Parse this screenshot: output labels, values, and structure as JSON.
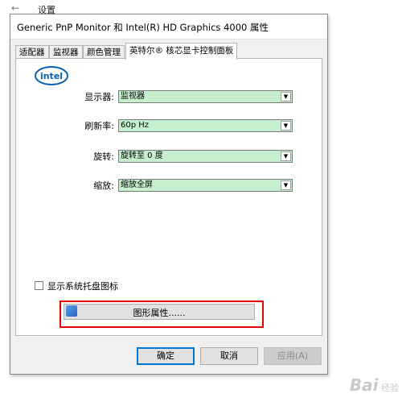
{
  "background_window": {
    "back_glyph": "←",
    "title": "设置"
  },
  "dialog": {
    "title": "Generic PnP Monitor 和 Intel(R) HD Graphics 4000 属性",
    "tabs": [
      "适配器",
      "监视器",
      "颜色管理",
      "英特尔® 核芯显卡控制面板"
    ],
    "active_tab": 3
  },
  "panel": {
    "logo_text": "intel",
    "rows": [
      {
        "label": "显示器:",
        "value": "监视器"
      },
      {
        "label": "刷新率:",
        "value": "60p Hz"
      },
      {
        "label": "旋转:",
        "value": "旋转至 0 度"
      },
      {
        "label": "缩放:",
        "value": "缩放全屏"
      }
    ],
    "select_color": "#c6efce",
    "tray_checkbox": {
      "label": "显示系统托盘图标",
      "checked": false
    },
    "graphics_button": {
      "label": "图形属性......",
      "highlight_color": "#e00000"
    }
  },
  "buttons": {
    "ok": "确定",
    "cancel": "取消",
    "apply": "应用(A)"
  },
  "watermark": {
    "brand": "Bai",
    "sub": "经验"
  }
}
